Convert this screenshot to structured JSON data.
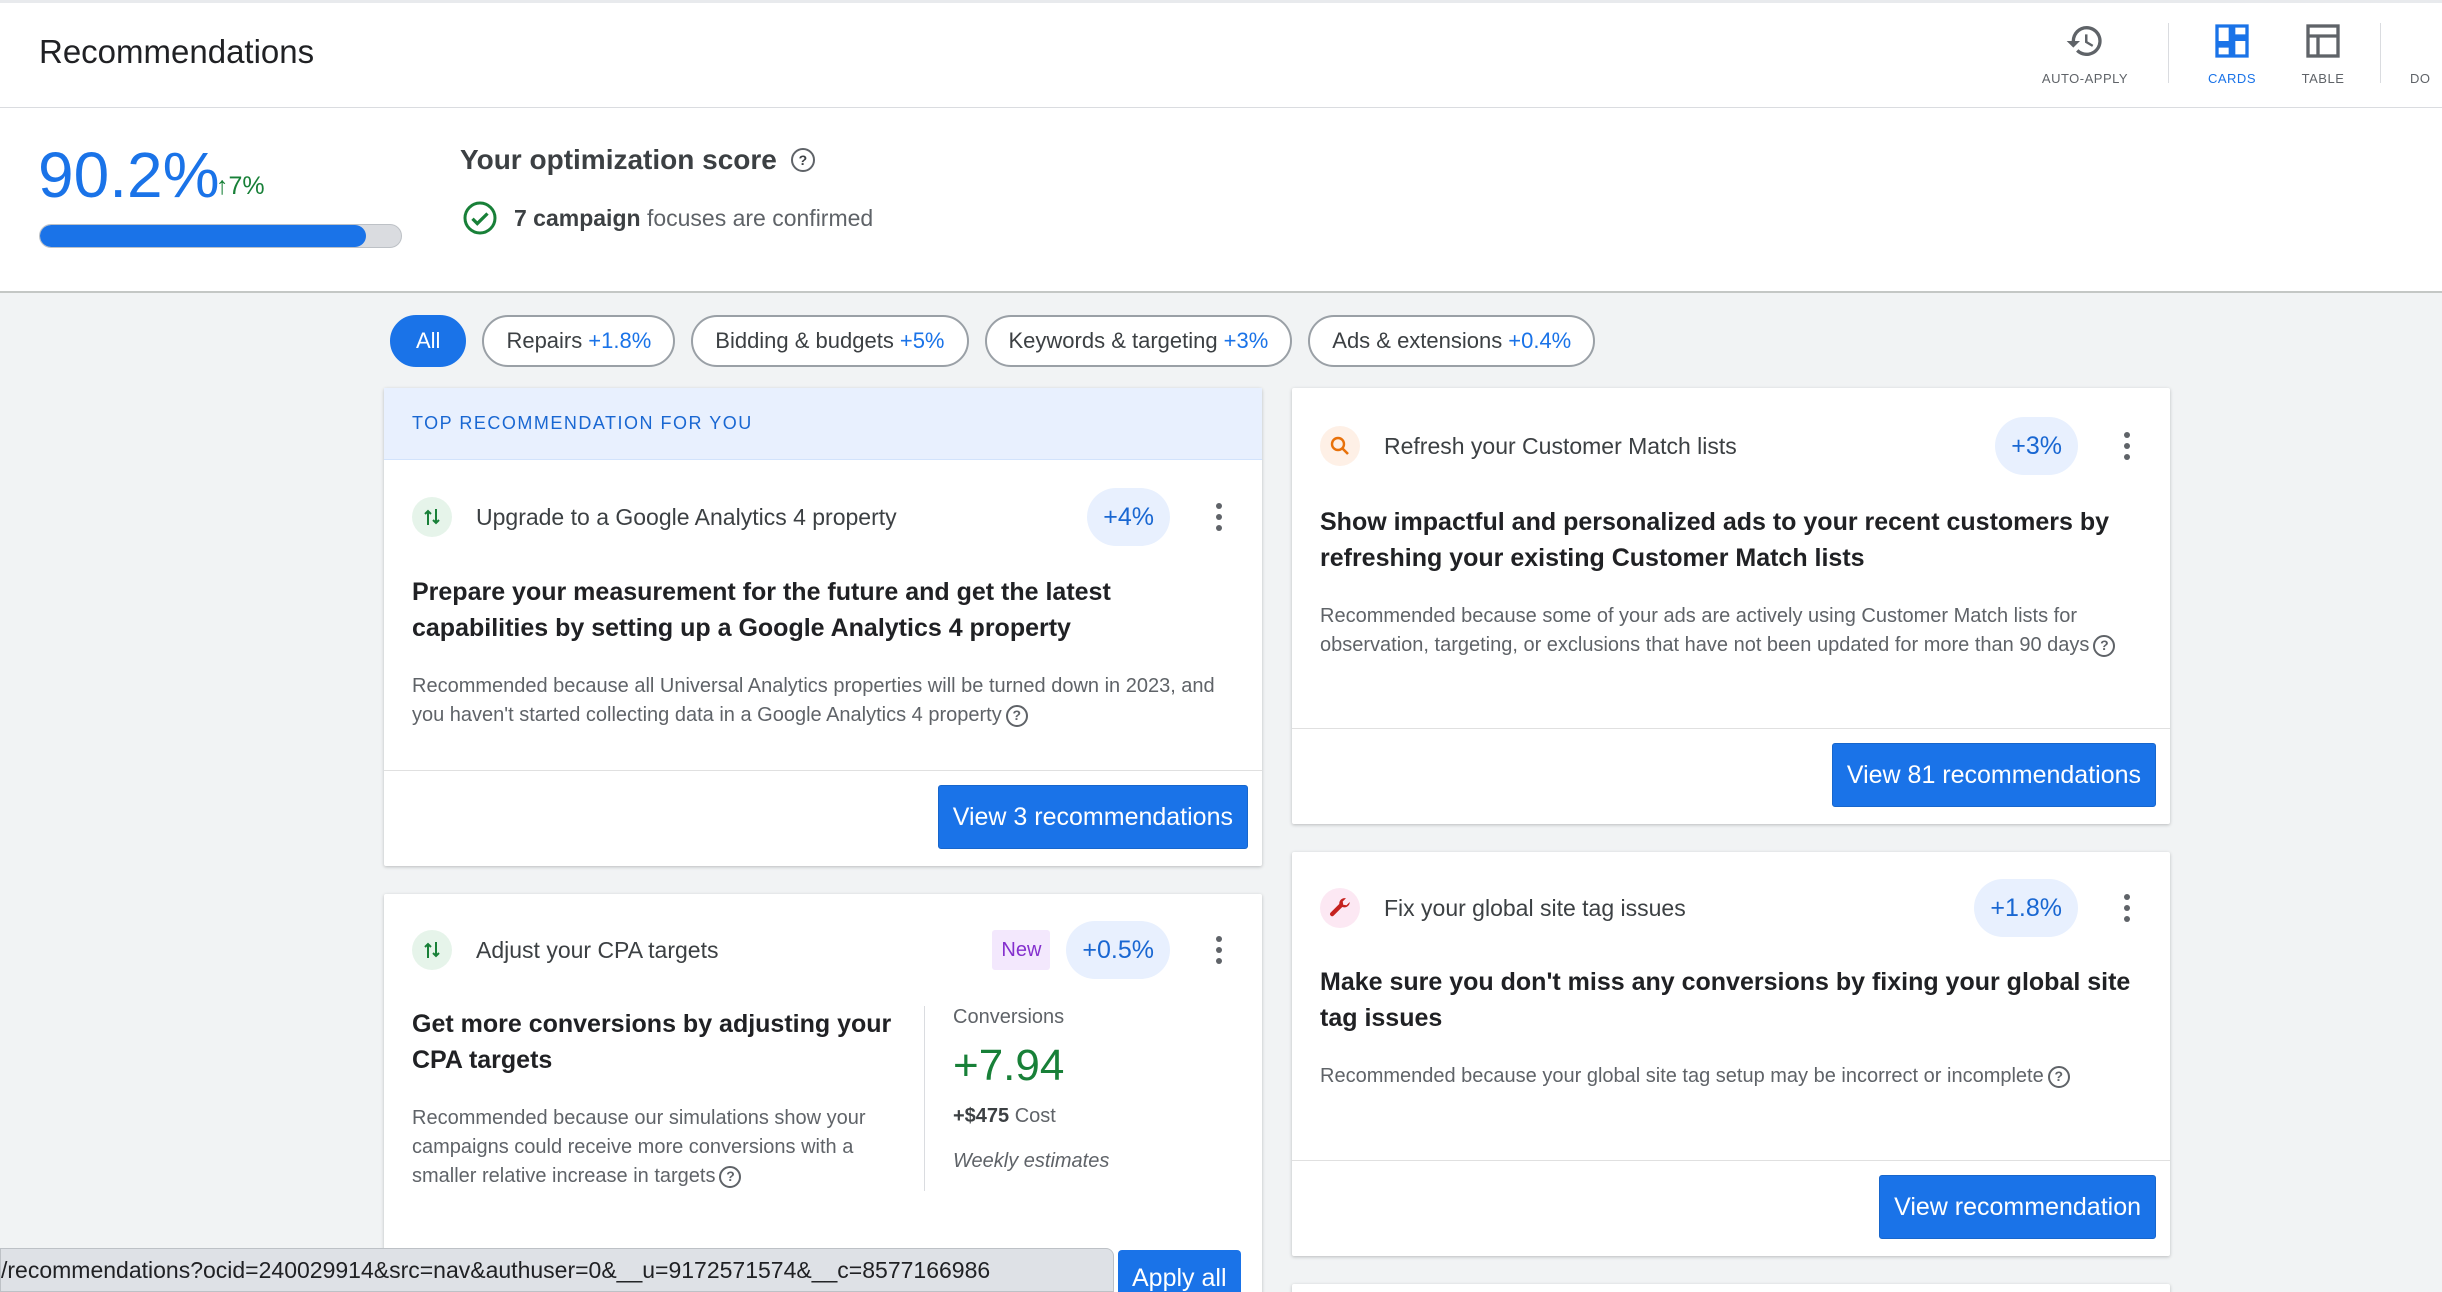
{
  "header": {
    "title": "Recommendations",
    "tools": [
      {
        "label": "AUTO-APPLY",
        "icon": "history-icon"
      },
      {
        "label": "CARDS",
        "icon": "dashboard-icon"
      },
      {
        "label": "TABLE",
        "icon": "table-icon"
      },
      {
        "label": "DO",
        "icon": "download-icon"
      }
    ]
  },
  "score": {
    "value": "90.2%",
    "delta": "7%",
    "progress_fraction": 0.902,
    "title": "Your optimization score",
    "sub_bold": "7 campaign",
    "sub_rest": "focuses are confirmed"
  },
  "chips": [
    {
      "label": "All",
      "pct": ""
    },
    {
      "label": "Repairs",
      "pct": "+1.8%"
    },
    {
      "label": "Bidding & budgets",
      "pct": "+5%"
    },
    {
      "label": "Keywords & targeting",
      "pct": "+3%"
    },
    {
      "label": "Ads & extensions",
      "pct": "+0.4%"
    }
  ],
  "cards": {
    "ga4": {
      "banner": "TOP RECOMMENDATION FOR YOU",
      "title": "Upgrade to a Google Analytics 4 property",
      "pct": "+4%",
      "headline": "Prepare your measurement for the future and get the latest capabilities by setting up a Google Analytics 4 property",
      "reason": "Recommended because all Universal Analytics properties will be turned down in 2023, and you haven't started collecting data in a Google Analytics 4 property",
      "button": "View 3 recommendations"
    },
    "cpa": {
      "title": "Adjust your CPA targets",
      "new_badge": "New",
      "pct": "+0.5%",
      "headline": "Get more conversions by adjusting your CPA targets",
      "reason": "Recommended because our simulations show your campaigns could receive more conversions with a smaller relative increase in targets",
      "conv_label": "Conversions",
      "conv_value": "+7.94",
      "cost_value": "+$475",
      "cost_label": "Cost",
      "note": "Weekly estimates"
    },
    "match": {
      "title": "Refresh your Customer Match lists",
      "pct": "+3%",
      "headline": "Show impactful and personalized ads to your recent customers by refreshing your existing Customer Match lists",
      "reason": "Recommended because some of your ads are actively using Customer Match lists for observation, targeting, or exclusions that have not been updated for more than 90 days",
      "button": "View 81 recommendations"
    },
    "tag": {
      "title": "Fix your global site tag issues",
      "pct": "+1.8%",
      "headline": "Make sure you don't miss any conversions by fixing your global site tag issues",
      "reason": "Recommended because your global site tag setup may be incorrect or incomplete",
      "button": "View recommendation"
    }
  },
  "status_url": "/recommendations?ocid=240029914&src=nav&authuser=0&__u=9172571574&__c=8577166986",
  "apply_all": "Apply all",
  "colors": {
    "accent": "#1a73e8",
    "positive": "#188038",
    "banner_bg": "#e8f0fe",
    "new_badge": "#8430ce"
  }
}
